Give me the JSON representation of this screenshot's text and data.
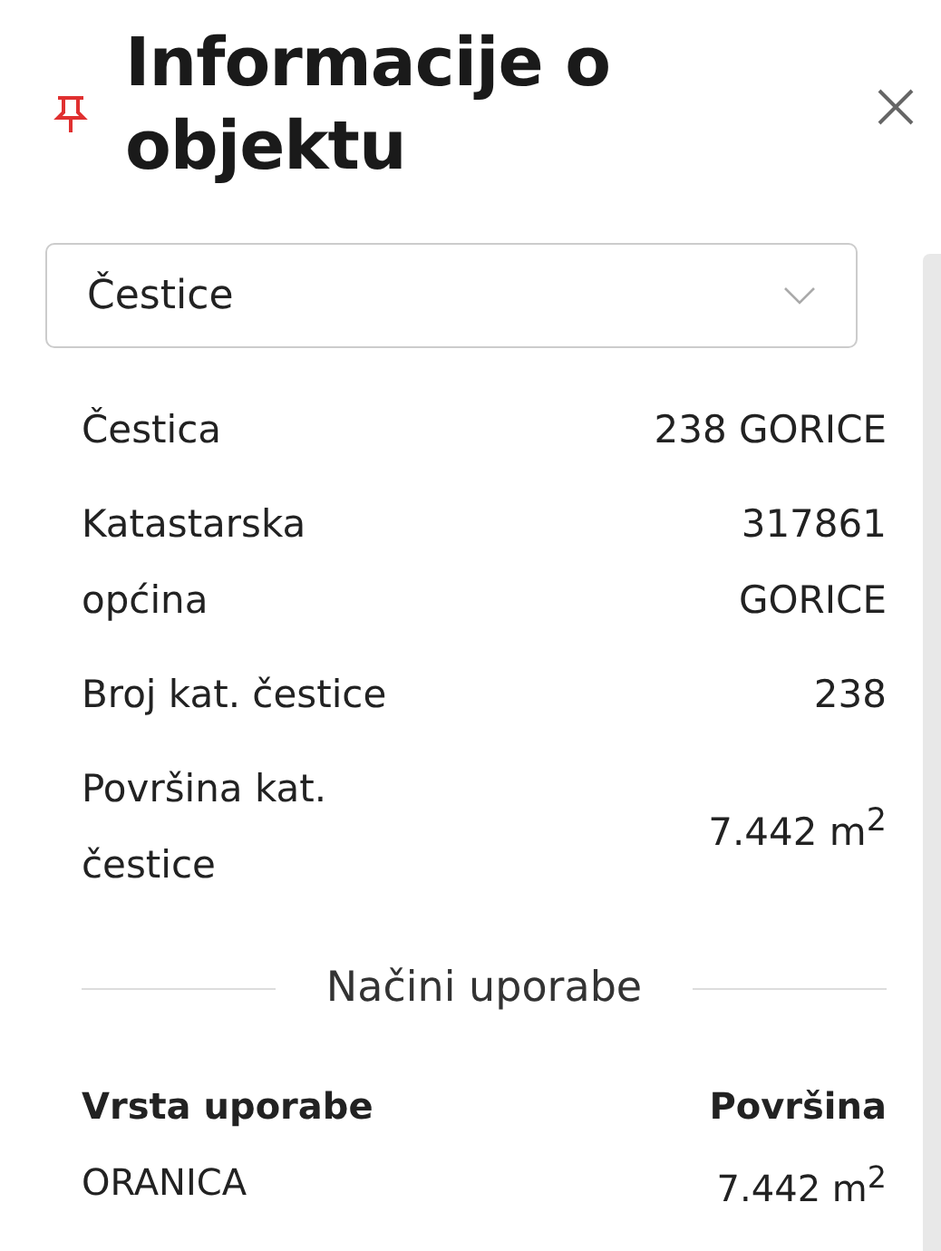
{
  "panel": {
    "title": "Informacije o objektu",
    "pinned": true
  },
  "dropdown": {
    "value": "Čestice"
  },
  "details": [
    {
      "label": "Čestica",
      "value": "238 GORICE"
    },
    {
      "label": "Katastarska općina",
      "value": "317861 GORICE"
    },
    {
      "label": "Broj kat. čestice",
      "value": "238"
    },
    {
      "label": "Površina kat. čestice",
      "value": "7.442 m$^{2}$"
    }
  ],
  "section": {
    "title": "Načini uporabe"
  },
  "table": {
    "columns": [
      "Vrsta uporabe",
      "Površina"
    ],
    "rows": [
      [
        "ORANICA",
        "7.442 m$^{2}$"
      ]
    ]
  }
}
